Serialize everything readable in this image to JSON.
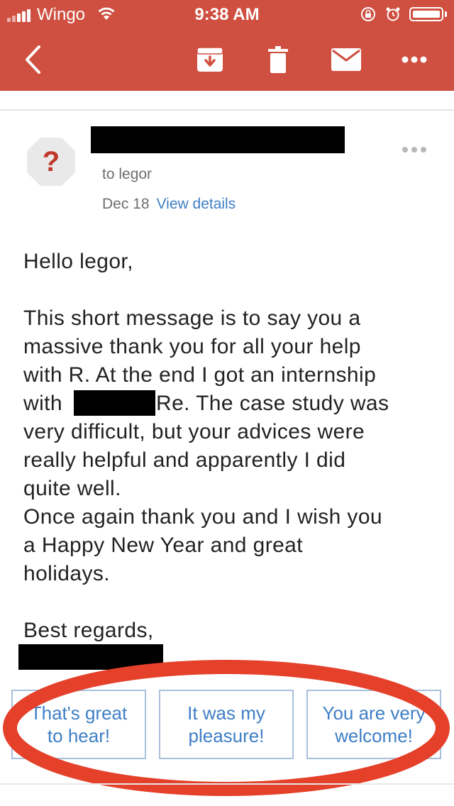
{
  "status_bar": {
    "carrier": "Wingo",
    "time": "9:38 AM"
  },
  "toolbar": {
    "icons": [
      "back-arrow-icon",
      "archive-icon",
      "trash-icon",
      "mail-icon",
      "more-icon"
    ]
  },
  "email": {
    "recipient_line": "to legor",
    "date": "Dec 18",
    "view_details": "View details",
    "greeting": "Hello legor,",
    "lines": [
      "This short message is to say you a",
      "massive thank you for all your help",
      "with R. At the end I got an internship",
      "with",
      "Re. The case study was",
      "very difficult, but your advices were",
      "really helpful and apparently I did",
      "quite well.",
      "Once again thank you and I wish you",
      "a Happy New Year and great",
      "holidays."
    ],
    "signoff": "Best regards,"
  },
  "smart_replies": [
    {
      "line1": "That's great",
      "line2": "to hear!"
    },
    {
      "line1": "It was my",
      "line2": "pleasure!"
    },
    {
      "line1": "You are very",
      "line2": "welcome!"
    }
  ],
  "colors": {
    "header": "#cf4f40",
    "link": "#3f7fc6",
    "highlight_circle": "#e4402a"
  }
}
